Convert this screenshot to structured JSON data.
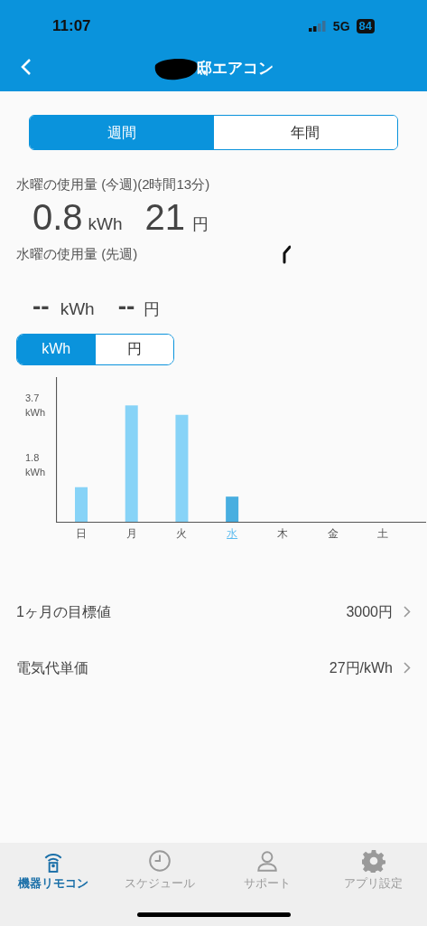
{
  "status_bar": {
    "time": "11:07",
    "network": "5G",
    "battery": "84"
  },
  "header": {
    "title": "邸エアコン"
  },
  "period_tabs": [
    {
      "label": "週間",
      "selected": true
    },
    {
      "label": "年間",
      "selected": false
    }
  ],
  "this_week": {
    "label": "水曜の使用量 (今週)(2時間13分)",
    "kwh": "0.8",
    "kwh_unit": "kWh",
    "cost": "21",
    "cost_unit": "円"
  },
  "last_week": {
    "label": "水曜の使用量 (先週)",
    "kwh": "--",
    "kwh_unit": "kWh",
    "cost": "--",
    "cost_unit": "円"
  },
  "unit_tabs": [
    {
      "label": "kWh",
      "selected": true
    },
    {
      "label": "円",
      "selected": false
    }
  ],
  "chart_data": {
    "type": "bar",
    "categories": [
      "日",
      "月",
      "火",
      "水",
      "木",
      "金",
      "土"
    ],
    "ylim": [
      0,
      4.6
    ],
    "yticks": [
      {
        "value": 1.8,
        "label": "1.8 kWh"
      },
      {
        "value": 3.7,
        "label": "3.7 kWh"
      }
    ],
    "series": [
      {
        "color": "#87d3f7",
        "values": [
          1.1,
          3.7,
          3.4,
          null,
          null,
          null,
          null
        ]
      },
      {
        "color": "#48aee0",
        "values": [
          null,
          null,
          null,
          0.8,
          null,
          null,
          null
        ]
      }
    ]
  },
  "settings": [
    {
      "label": "1ヶ月の目標値",
      "value": "3000円"
    },
    {
      "label": "電気代単価",
      "value": "27円/kWh"
    }
  ],
  "tab_bar": [
    {
      "label": "機器リモコン",
      "kind": "remote",
      "selected": true
    },
    {
      "label": "スケジュール",
      "kind": "clock",
      "selected": false
    },
    {
      "label": "サポート",
      "kind": "person",
      "selected": false
    },
    {
      "label": "アプリ設定",
      "kind": "gear",
      "selected": false
    }
  ]
}
